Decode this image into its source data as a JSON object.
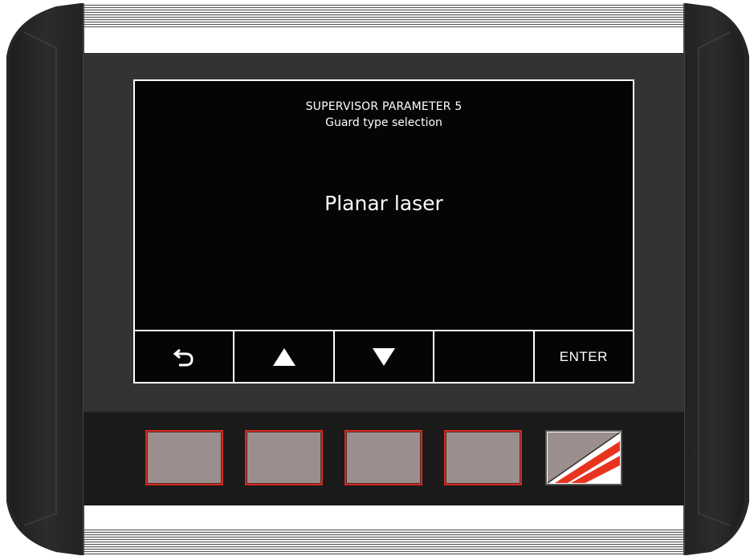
{
  "screen": {
    "title": "SUPERVISOR PARAMETER 5",
    "subtitle": "Guard type selection",
    "value": "Planar laser"
  },
  "softkeys": [
    {
      "icon": "back-arrow-icon",
      "label": ""
    },
    {
      "icon": "up-triangle-icon",
      "label": ""
    },
    {
      "icon": "down-triangle-icon",
      "label": ""
    },
    {
      "icon": "",
      "label": ""
    },
    {
      "icon": "",
      "label": "ENTER"
    }
  ],
  "colors": {
    "screen_bg": "#050505",
    "housing_dark": "#2a2a2a",
    "button_fill": "#9b8f8e",
    "button_border": "#d42a1f",
    "logo_red": "#e8341f"
  }
}
